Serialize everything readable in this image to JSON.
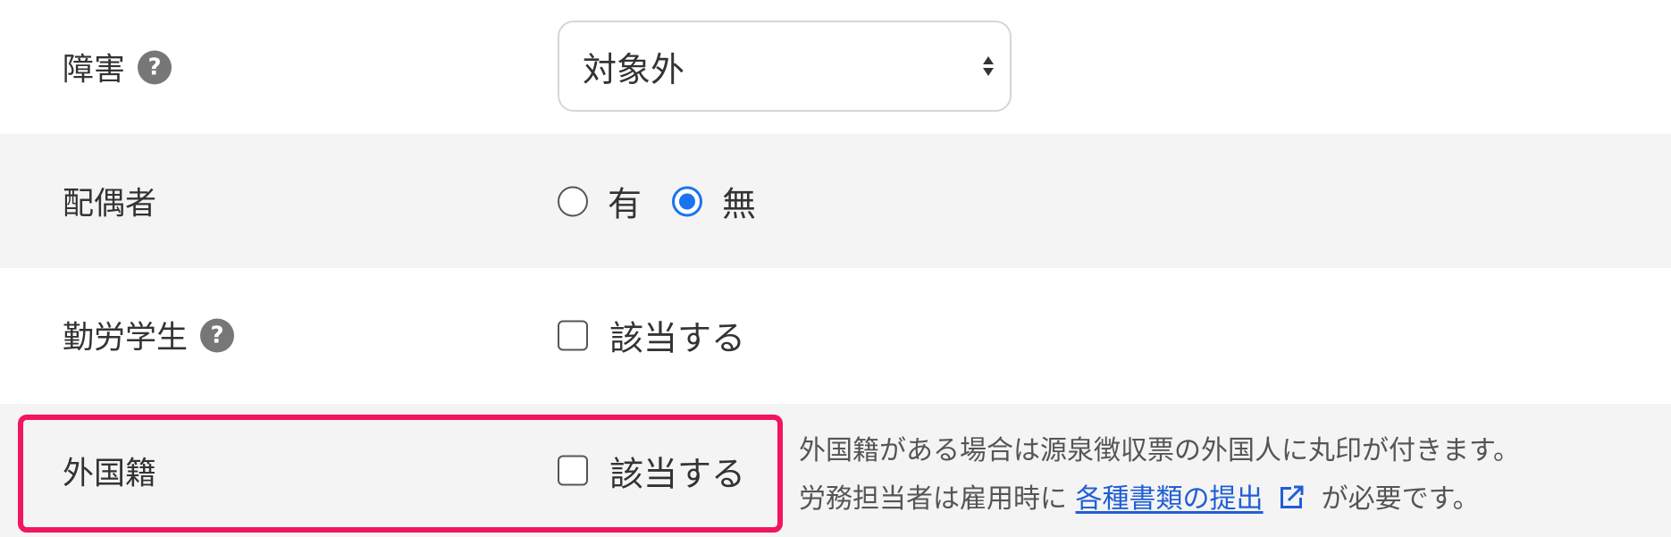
{
  "rows": {
    "disability": {
      "label": "障害",
      "select_value": "対象外"
    },
    "spouse": {
      "label": "配偶者",
      "options": [
        "有",
        "無"
      ],
      "selected": "無"
    },
    "working_student": {
      "label": "勤労学生",
      "checkbox_label": "該当する",
      "checked": false
    },
    "foreign_national": {
      "label": "外国籍",
      "checkbox_label": "該当する",
      "checked": false,
      "note_line1": "外国籍がある場合は源泉徴収票の外国人に丸印が付きます。",
      "note_line2_before": "労務担当者は雇用時に",
      "note_link": "各種書類の提出",
      "note_line2_after": "が必要です。"
    }
  },
  "icons": {
    "help": "?"
  },
  "colors": {
    "highlight_border": "#f2165e",
    "radio_selected": "#1a73f0",
    "link": "#1f5fd6",
    "alt_row_bg": "#f5f4f4"
  }
}
